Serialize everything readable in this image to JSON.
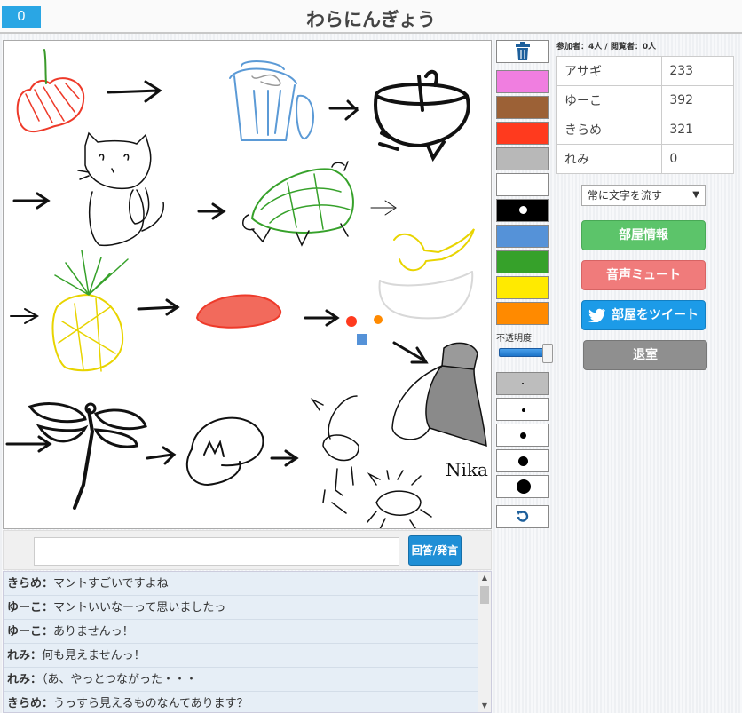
{
  "header": {
    "score": "0",
    "title": "わらにんぎょう"
  },
  "answer": {
    "placeholder": "",
    "button_label": "回答/発言"
  },
  "chat": [
    {
      "name": "きらめ",
      "sep": "：",
      "message": "マントすごいですよね"
    },
    {
      "name": "ゆーこ",
      "sep": "：",
      "message": "マントいいなーって思いましたっ"
    },
    {
      "name": "ゆーこ",
      "sep": "：",
      "message": "ありませんっ！"
    },
    {
      "name": "れみ",
      "sep": "：",
      "message": "何も見えませんっ！"
    },
    {
      "name": "れみ",
      "sep": "：",
      "message": "（あ、やっとつながった・・・"
    },
    {
      "name": "きらめ",
      "sep": "：",
      "message": "うっすら見えるものなんてあります？"
    }
  ],
  "tools": {
    "trash_icon": "trash-icon",
    "colors": [
      "#f07ee0",
      "#9c6136",
      "#ff3a1e",
      "#b8b8b8",
      "#ffffff",
      "#000000",
      "#5592d8",
      "#36a12a",
      "#ffea00",
      "#ff8a00"
    ],
    "opacity_label": "不透明度",
    "opacity_value": 1.0,
    "undo_icon": "undo-icon"
  },
  "players": {
    "count_label": "参加者：4人 / 閲覧者：0人",
    "list": [
      {
        "name": "アサギ",
        "score": "233"
      },
      {
        "name": "ゆーこ",
        "score": "392"
      },
      {
        "name": "きらめ",
        "score": "321"
      },
      {
        "name": "れみ",
        "score": "0"
      }
    ]
  },
  "controls": {
    "flow_select": "常に文字を流す",
    "room_info": "部屋情報",
    "mute": "音声ミュート",
    "tweet": "部屋をツイート",
    "leave": "退室"
  },
  "canvas": {
    "signature": "Nika"
  }
}
